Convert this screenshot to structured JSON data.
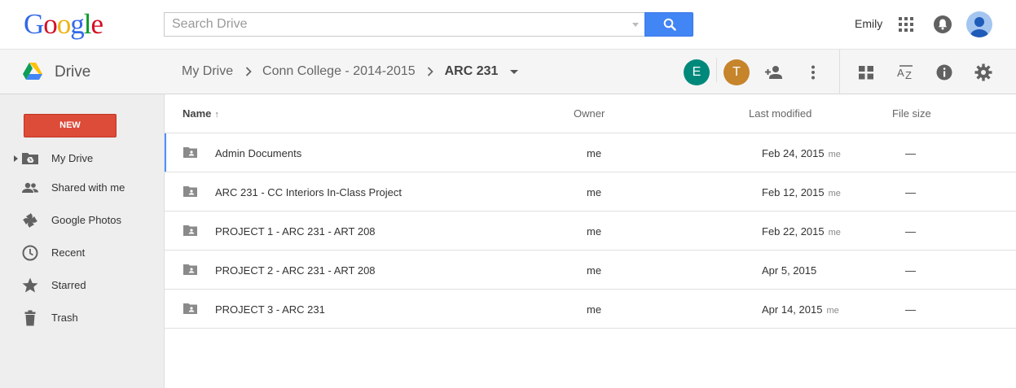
{
  "header": {
    "logo_letters": [
      {
        "ch": "G",
        "color": "#3369e8"
      },
      {
        "ch": "o",
        "color": "#d50f25"
      },
      {
        "ch": "o",
        "color": "#eeb211"
      },
      {
        "ch": "g",
        "color": "#3369e8"
      },
      {
        "ch": "l",
        "color": "#009925"
      },
      {
        "ch": "e",
        "color": "#d50f25"
      }
    ],
    "search_placeholder": "Search Drive",
    "user_name": "Emily"
  },
  "appbar": {
    "product_name": "Drive",
    "breadcrumbs": [
      "My Drive",
      "Conn College - 2014-2015"
    ],
    "current_folder": "ARC 231",
    "collaborators": [
      {
        "initial": "E",
        "color": "#00897b"
      },
      {
        "initial": "T",
        "color": "#c6842b"
      }
    ]
  },
  "sidebar": {
    "new_label": "NEW",
    "items": [
      {
        "label": "My Drive",
        "icon": "my-drive-icon"
      },
      {
        "label": "Shared with me",
        "icon": "shared-people-icon"
      },
      {
        "label": "Google Photos",
        "icon": "photos-pinwheel-icon"
      },
      {
        "label": "Recent",
        "icon": "clock-icon"
      },
      {
        "label": "Starred",
        "icon": "star-icon"
      },
      {
        "label": "Trash",
        "icon": "trash-icon"
      }
    ]
  },
  "list": {
    "columns": {
      "name": "Name",
      "sort_arrow": "↑",
      "owner": "Owner",
      "modified": "Last modified",
      "size": "File size"
    },
    "rows": [
      {
        "name": "Admin Documents",
        "owner": "me",
        "modified": "Feb 24, 2015",
        "modified_by": "me",
        "size": "—",
        "selected": true
      },
      {
        "name": "ARC 231 - CC Interiors In-Class Project",
        "owner": "me",
        "modified": "Feb 12, 2015",
        "modified_by": "me",
        "size": "—"
      },
      {
        "name": "PROJECT 1 - ARC 231 - ART 208",
        "owner": "me",
        "modified": "Feb 22, 2015",
        "modified_by": "me",
        "size": "—"
      },
      {
        "name": "PROJECT 2 - ARC 231 - ART 208",
        "owner": "me",
        "modified": "Apr 5, 2015",
        "modified_by": "",
        "size": "—"
      },
      {
        "name": "PROJECT 3 - ARC 231",
        "owner": "me",
        "modified": "Apr 14, 2015",
        "modified_by": "me",
        "size": "—"
      }
    ]
  }
}
